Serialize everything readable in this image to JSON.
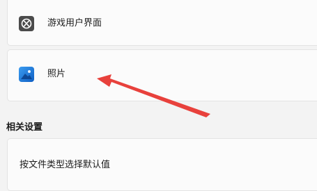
{
  "apps": {
    "xbox": {
      "label": "游戏用户界面",
      "icon": "xbox-icon",
      "icon_color": "#4b4b4b"
    },
    "photos": {
      "label": "照片",
      "icon": "photos-icon",
      "icon_color": "#1a73d9"
    }
  },
  "section": {
    "title": "相关设置"
  },
  "default_by_file_type": {
    "label": "按文件类型选择默认值"
  },
  "annotation": {
    "arrow_color": "#e8413c"
  }
}
